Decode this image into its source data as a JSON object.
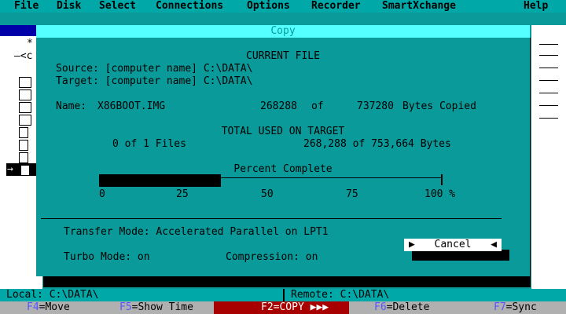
{
  "menu": [
    "File",
    "Disk",
    "Select",
    "Connections",
    "Options",
    "Recorder",
    "SmartXchange",
    "Help"
  ],
  "background": {
    "left_frag1": "*",
    "left_frag2": "—<c"
  },
  "dialog": {
    "title": "Copy",
    "current_file_heading": "CURRENT FILE",
    "source": "Source: [computer name] C:\\DATA\\",
    "target": "Target: [computer name] C:\\DATA\\",
    "name_label": "Name:",
    "file_name": "X86BOOT.IMG",
    "bytes_copied": "268288",
    "of_label": "of",
    "file_total": "737280",
    "bytes_copied_label": "Bytes Copied",
    "total_heading": "TOTAL USED ON TARGET",
    "files_done": "0 of 1 Files",
    "bytes_summary": "268,288 of 753,664 Bytes",
    "percent_heading": "Percent Complete",
    "progress_percent": 35.6,
    "ticks": [
      "0",
      "25",
      "50",
      "75",
      "100 %"
    ],
    "transfer_mode": "Transfer Mode: Accelerated Parallel on LPT1",
    "turbo_mode": "Turbo Mode: on",
    "compression": "Compression: on",
    "cancel_label": "Cancel"
  },
  "status": {
    "local": "Local: C:\\DATA\\",
    "remote": "Remote: C:\\DATA\\"
  },
  "fkeys": [
    {
      "key": "F4",
      "text": "=Move"
    },
    {
      "key": "F5",
      "text": "=Show Time"
    },
    {
      "key": "F2",
      "text": "=COPY ▶▶▶"
    },
    {
      "key": "F6",
      "text": "=Delete"
    },
    {
      "key": "F7",
      "text": "=Sync"
    }
  ],
  "colors": {
    "dialog_bg": "#0a9a9a",
    "title_bar": "#55ffff",
    "copy_key_bg": "#a80000"
  }
}
